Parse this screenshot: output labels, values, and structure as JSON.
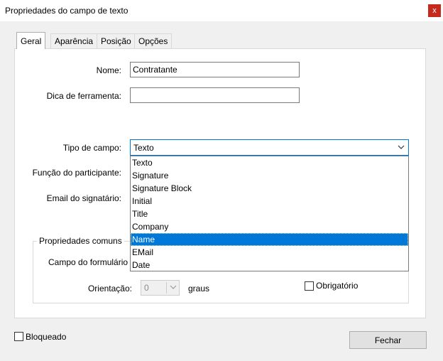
{
  "window": {
    "title": "Propriedades do campo de texto",
    "close_glyph": "x"
  },
  "tabs": [
    {
      "label": "Geral",
      "active": true
    },
    {
      "label": "Aparência",
      "active": false
    },
    {
      "label": "Posição",
      "active": false
    },
    {
      "label": "Opções",
      "active": false
    }
  ],
  "fields": {
    "name_label": "Nome:",
    "name_value": "Contratante",
    "tooltip_label": "Dica de ferramenta:",
    "tooltip_value": "",
    "field_type_label": "Tipo de campo:",
    "field_type_value": "Texto",
    "participant_role_label": "Função do participante:",
    "signer_email_label": "Email do signatário:"
  },
  "dropdown": {
    "options": [
      "Texto",
      "Signature",
      "Signature Block",
      "Initial",
      "Title",
      "Company",
      "Name",
      "EMail",
      "Date"
    ],
    "selected_index": 6
  },
  "common_properties": {
    "group_title": "Propriedades comuns",
    "form_field_label": "Campo do formulário",
    "orientation_label": "Orientação:",
    "orientation_value": "0",
    "degrees_label": "graus",
    "required_label": "Obrigatório",
    "required_checked": false
  },
  "footer": {
    "locked_label": "Bloqueado",
    "locked_checked": false,
    "close_button_label": "Fechar"
  },
  "icons": {
    "close": "close-icon",
    "dropdown_arrow": "chevron-down-icon"
  },
  "colors": {
    "accent": "#0078d7",
    "close_button": "#c42b1c"
  }
}
